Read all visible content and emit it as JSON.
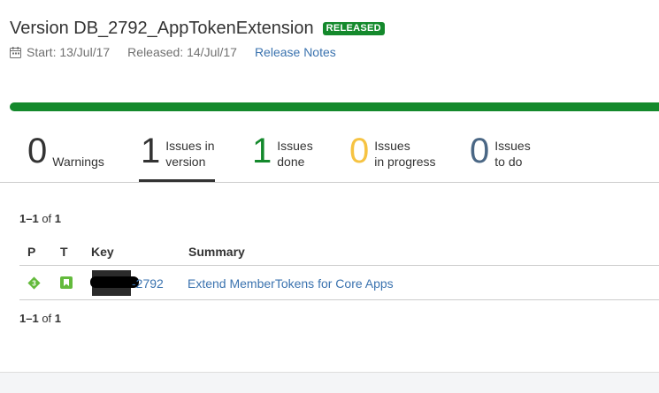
{
  "header": {
    "title": "Version DB_2792_AppTokenExtension",
    "badge": "RELEASED",
    "start": "Start: 13/Jul/17",
    "released": "Released: 14/Jul/17",
    "release_notes": "Release Notes"
  },
  "progress": {
    "done_fraction": 1.0,
    "color": "#14892c"
  },
  "stats": [
    {
      "value": "0",
      "label_1": "Warnings",
      "label_2": ""
    },
    {
      "value": "1",
      "label_1": "Issues in",
      "label_2": "version"
    },
    {
      "value": "1",
      "label_1": "Issues",
      "label_2": "done"
    },
    {
      "value": "0",
      "label_1": "Issues",
      "label_2": "in progress"
    },
    {
      "value": "0",
      "label_1": "Issues",
      "label_2": "to do"
    }
  ],
  "pager": {
    "range": "1–1",
    "of": "of",
    "total": "1"
  },
  "table": {
    "columns": [
      "P",
      "T",
      "Key",
      "Summary"
    ],
    "rows": [
      {
        "priority_icon": "priority-3-icon",
        "type_icon": "story-icon",
        "key_visible": "-2792",
        "summary": "Extend MemberTokens for Core Apps"
      }
    ]
  },
  "colors": {
    "green": "#14892c",
    "yellow": "#f6c342",
    "blue": "#4a6785",
    "link": "#3b73af"
  }
}
